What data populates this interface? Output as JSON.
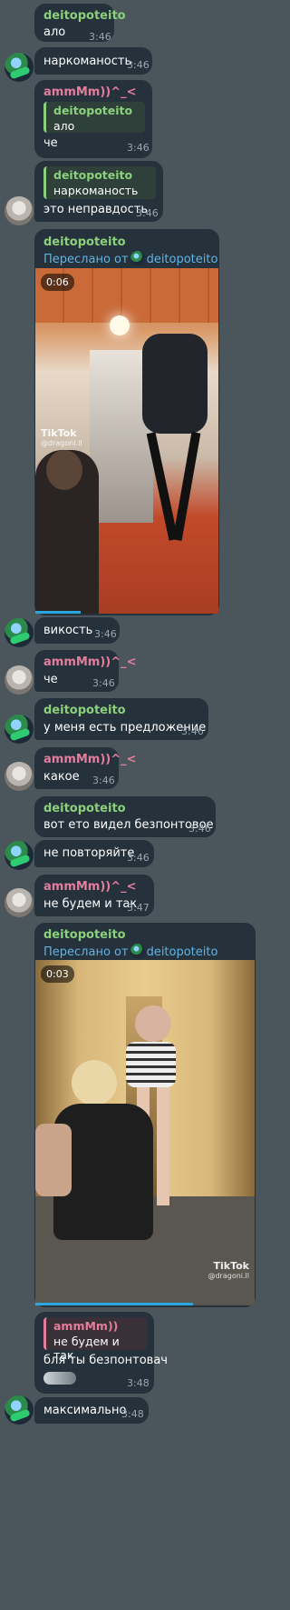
{
  "messages": [
    {
      "name": "deitopoteito",
      "text": "ало",
      "time": "3:46"
    },
    {
      "text": "наркоманость",
      "time": "3:46"
    },
    {
      "name": "ammMm))^_<",
      "reply_name": "deitopoteito",
      "reply_text": "ало",
      "text": "че",
      "time": "3:46"
    },
    {
      "reply_name": "deitopoteito",
      "reply_text": "наркоманость",
      "text": "это неправдость",
      "time": "3:46"
    },
    {
      "name": "deitopoteito",
      "forwarded_label": "Переслано от",
      "forwarded_from": "deitopoteito",
      "video_duration": "0:06",
      "video_progress": 0.25
    },
    {
      "text": "викость",
      "time": "3:46"
    },
    {
      "name": "ammMm))^_<",
      "text": "че",
      "time": "3:46"
    },
    {
      "name": "deitopoteito",
      "text": "у меня есть предложение",
      "time": "3:46"
    },
    {
      "name": "ammMm))^_<",
      "text": "какое",
      "time": "3:46"
    },
    {
      "name": "deitopoteito",
      "text": "вот ето видел безпонтовое",
      "time": "3:46"
    },
    {
      "text": "не повторяйте",
      "time": "3:46"
    },
    {
      "name": "ammMm))^_<",
      "text": "не будем и так",
      "time": "3:47"
    },
    {
      "name": "deitopoteito",
      "forwarded_label": "Переслано от",
      "forwarded_from": "deitopoteito",
      "video_duration": "0:03",
      "video_progress": 0.72
    },
    {
      "reply_name": "ammMm))",
      "reply_text": "не будем и так",
      "text": "бля ты безпонтовач",
      "time": "3:48"
    },
    {
      "text": "максимально",
      "time": "3:48"
    }
  ],
  "tiktok": {
    "brand": "TikTok",
    "handle": "@dragoni.ll"
  },
  "colors": {
    "background": "#4b565c",
    "bubble": "#25313b",
    "name_green": "#8bd17c",
    "name_pink": "#e57d9c",
    "forward_blue": "#5fb4e6"
  }
}
